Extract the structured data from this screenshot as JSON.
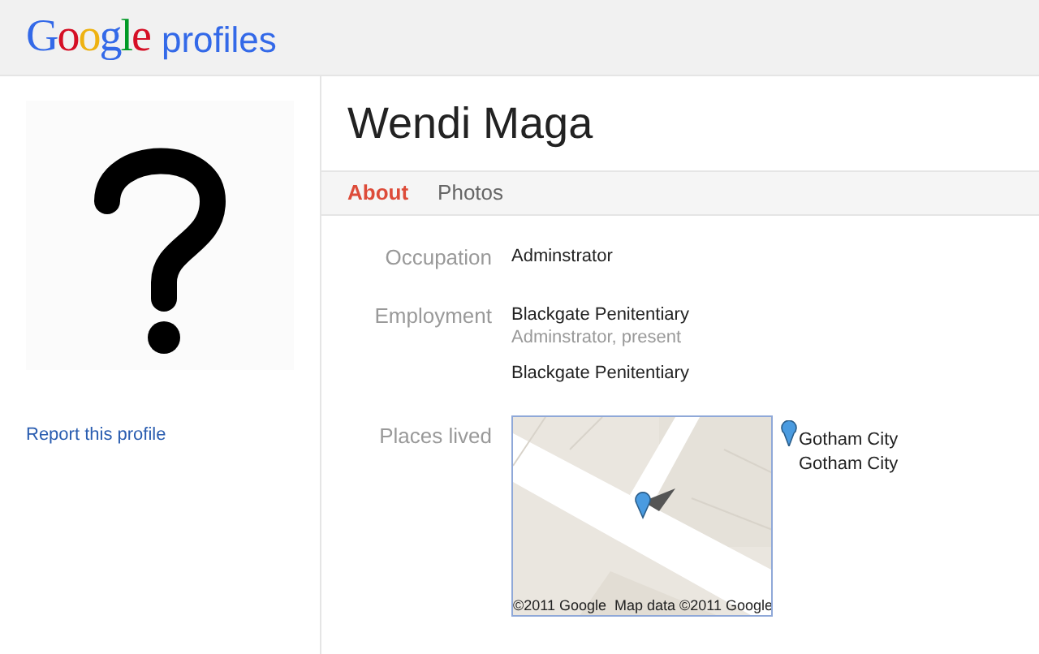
{
  "header": {
    "logo": "Google",
    "product": "profiles"
  },
  "sidebar": {
    "photo": {
      "kind": "placeholder"
    },
    "report_link": "Report this profile"
  },
  "profile": {
    "name": "Wendi Maga"
  },
  "tabs": [
    {
      "label": "About",
      "selected": true
    },
    {
      "label": "Photos",
      "selected": false
    }
  ],
  "fields": [
    {
      "label": "Occupation",
      "entries": [
        {
          "title": "Adminstrator"
        }
      ]
    },
    {
      "label": "Employment",
      "entries": [
        {
          "title": "Blackgate Penitentiary",
          "detail": "Adminstrator, present"
        },
        {
          "title": "Blackgate Penitentiary"
        }
      ]
    }
  ],
  "places": {
    "label": "Places lived",
    "map": {
      "kind": "picture",
      "attribution": "©2011 Google  Map data ©2011 Google"
    },
    "current": "Gotham City",
    "others": [
      "Gotham City"
    ]
  }
}
